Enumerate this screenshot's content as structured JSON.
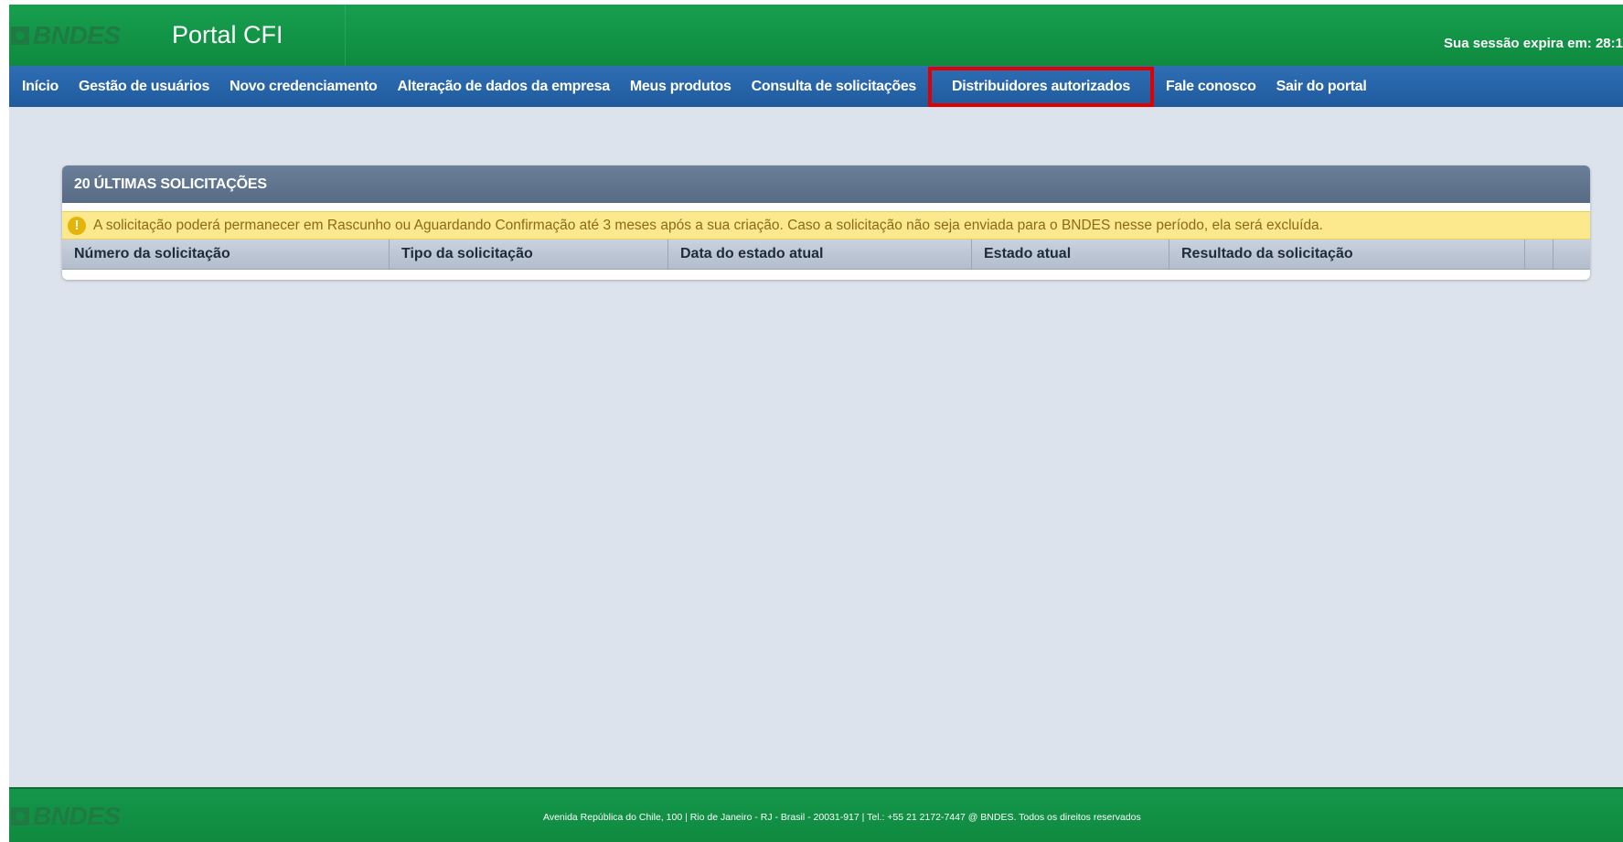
{
  "header": {
    "logo_text": "BNDES",
    "portal_title": "Portal CFI",
    "session_text": "Sua sessão expira em: 28:1"
  },
  "nav": {
    "items": [
      {
        "label": "Início"
      },
      {
        "label": "Gestão de usuários"
      },
      {
        "label": "Novo credenciamento"
      },
      {
        "label": "Alteração de dados da empresa"
      },
      {
        "label": "Meus produtos"
      },
      {
        "label": "Consulta de solicitações"
      },
      {
        "label": "Distribuidores autorizados",
        "highlighted": true
      },
      {
        "label": "Fale conosco"
      },
      {
        "label": "Sair do portal"
      }
    ],
    "highlight_color": "#e00000"
  },
  "panel": {
    "title": "20 ÚLTIMAS SOLICITAÇÕES",
    "alert_icon": "!",
    "alert_text": "A solicitação poderá permanecer em Rascunho ou Aguardando Confirmação até 3 meses após a sua criação. Caso a solicitação não seja enviada para o BNDES nesse período, ela será excluída.",
    "columns": [
      "Número da solicitação",
      "Tipo da solicitação",
      "Data do estado atual",
      "Estado atual",
      "Resultado da solicitação",
      "",
      ""
    ]
  },
  "footer": {
    "logo_text": "BNDES",
    "address": "Avenida República do Chile, 100 | Rio de Janeiro - RJ - Brasil - 20031-917 | Tel.: +55 21 2172-7447 @ BNDES. Todos os direitos reservados"
  },
  "colors": {
    "header_green": "#169f4e",
    "nav_blue": "#2f6eb4",
    "panel_header": "#6a7f99",
    "alert_bg": "#fde98d",
    "page_bg": "#dde3ec"
  }
}
